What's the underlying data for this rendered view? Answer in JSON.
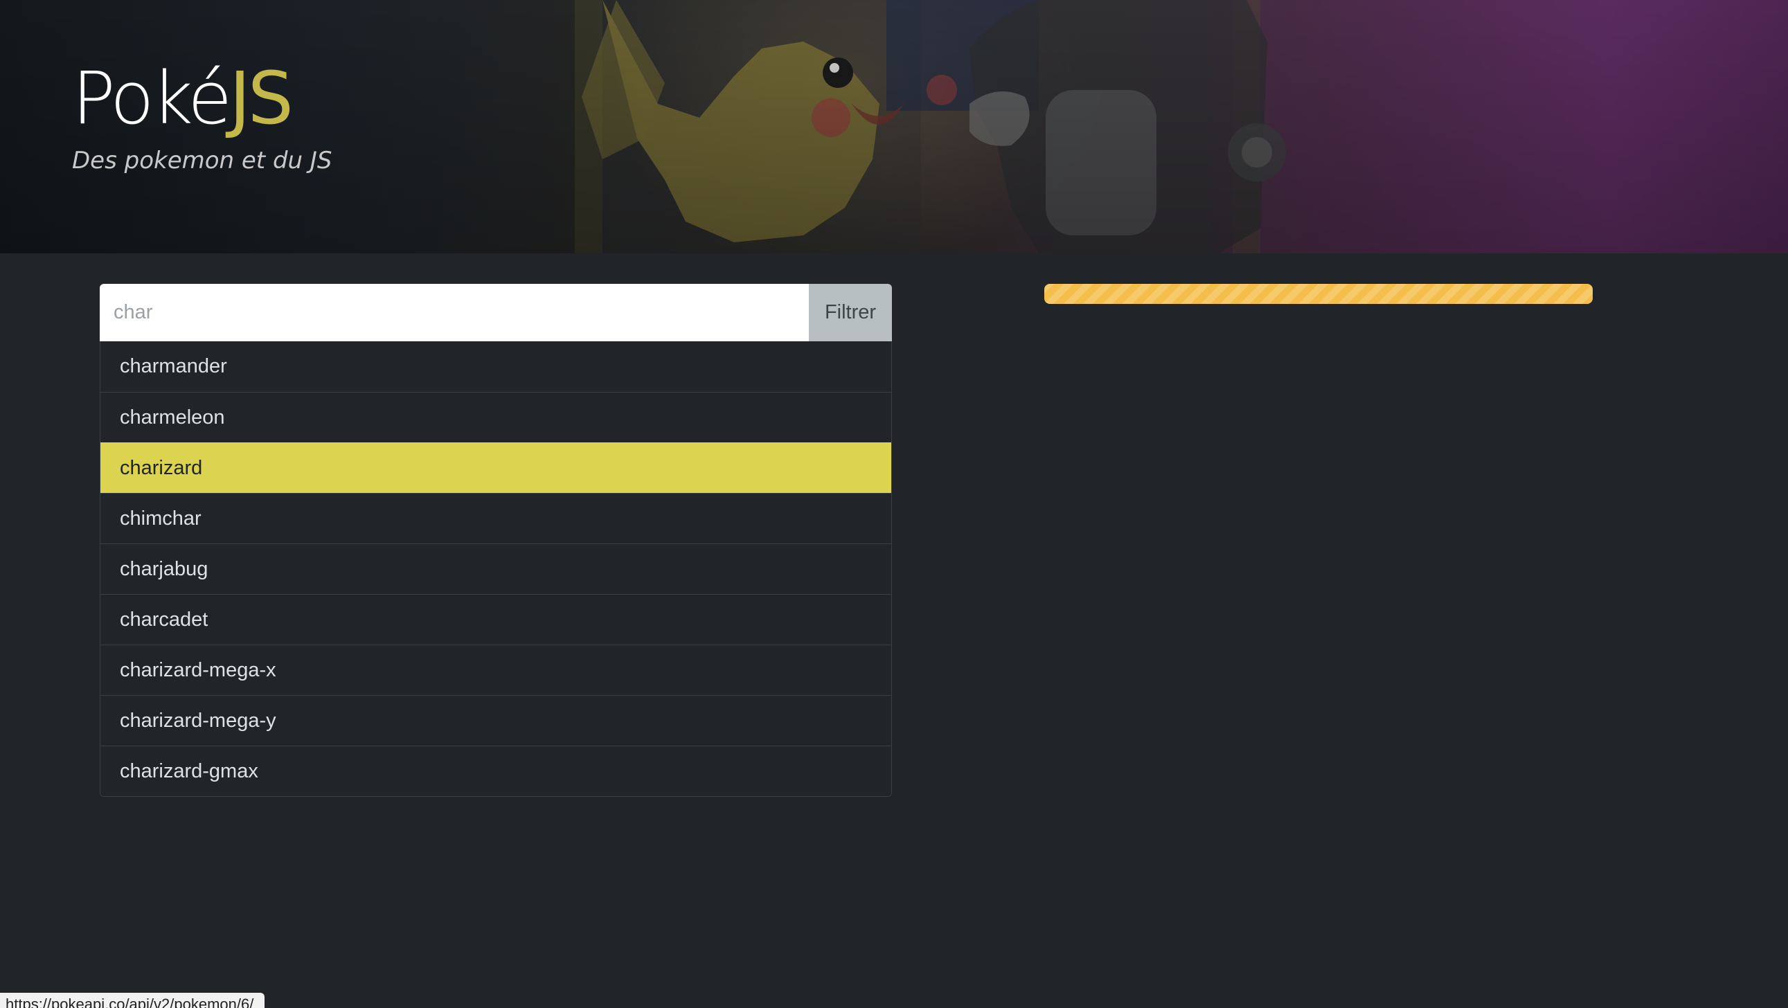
{
  "header": {
    "brand_main": "Poké",
    "brand_accent": "JS",
    "subtitle": "Des pokemon et du JS"
  },
  "search": {
    "placeholder": "char",
    "value": "",
    "filter_label": "Filtrer"
  },
  "results": [
    "charmander",
    "charmeleon",
    "charizard",
    "chimchar",
    "charjabug",
    "charcadet",
    "charizard-mega-x",
    "charizard-mega-y",
    "charizard-gmax"
  ],
  "selected_index": 2,
  "loading": {
    "progress_percent": 100,
    "color": "#f4be4a"
  },
  "status_bar": {
    "url": "https://pokeapi.co/api/v2/pokemon/6/"
  },
  "colors": {
    "accent": "#c5b84a",
    "highlight": "#dcd350",
    "background": "#212529"
  }
}
